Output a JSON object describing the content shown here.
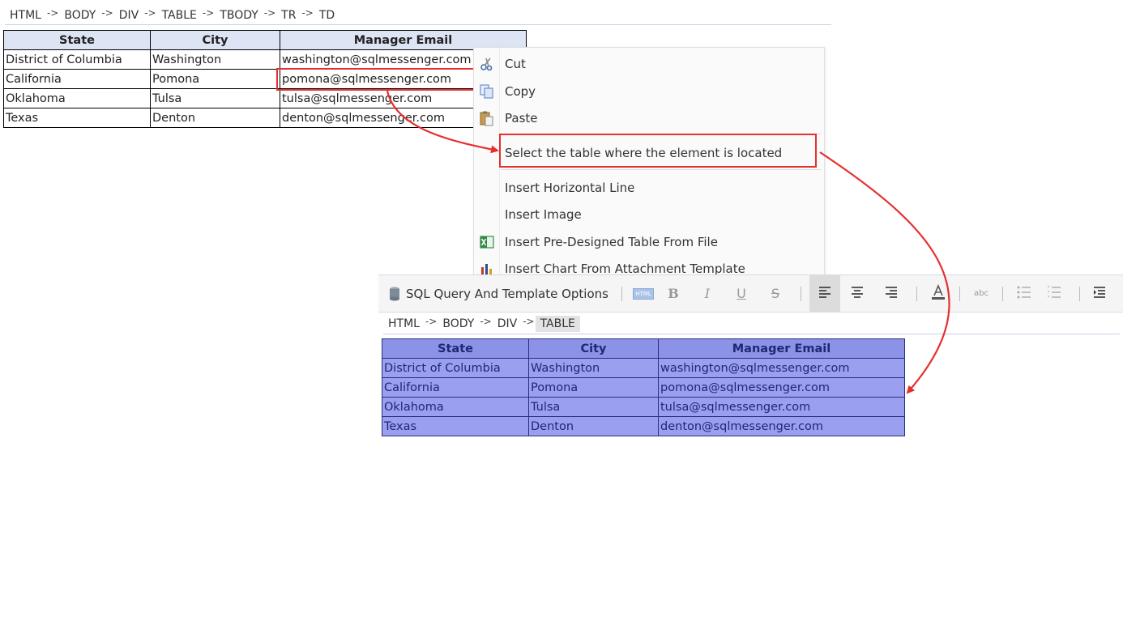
{
  "top_breadcrumb": [
    "HTML",
    "BODY",
    "DIV",
    "TABLE",
    "TBODY",
    "TR",
    "TD"
  ],
  "bottom_breadcrumb": [
    "HTML",
    "BODY",
    "DIV",
    "TABLE"
  ],
  "breadcrumb_separator": "->",
  "table": {
    "headers": [
      "State",
      "City",
      "Manager Email"
    ],
    "rows": [
      [
        "District of Columbia",
        "Washington",
        "washington@sqlmessenger.com"
      ],
      [
        "California",
        "Pomona",
        "pomona@sqlmessenger.com"
      ],
      [
        "Oklahoma",
        "Tulsa",
        "tulsa@sqlmessenger.com"
      ],
      [
        "Texas",
        "Denton",
        "denton@sqlmessenger.com"
      ]
    ]
  },
  "context_menu": {
    "cut": "Cut",
    "copy": "Copy",
    "paste": "Paste",
    "select_table": "Select the table where the element is located",
    "insert_hr": "Insert Horizontal Line",
    "insert_image": "Insert Image",
    "insert_table": "Insert Pre-Designed Table From File",
    "insert_chart": "Insert Chart From Attachment Template"
  },
  "toolbar": {
    "sql_options": "SQL Query And Template Options",
    "bold": "B",
    "italic": "I",
    "underline": "U",
    "strike": "S",
    "html_icon": "HTML",
    "spell": "abc"
  },
  "colors": {
    "highlight_red": "#e53030",
    "selected_table_fill": "#9aa0ef",
    "header_fill": "#dde4f4"
  }
}
